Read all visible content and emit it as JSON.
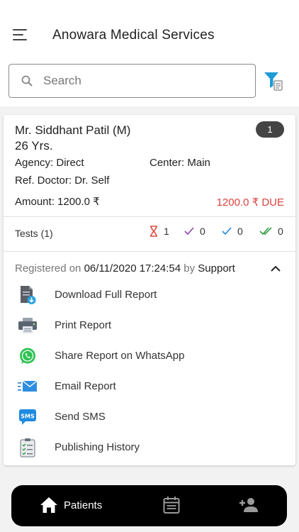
{
  "header": {
    "title": "Anowara Medical Services"
  },
  "search": {
    "placeholder": "Search",
    "value": ""
  },
  "patient": {
    "name": "Mr. Siddhant Patil (M)",
    "age": "26 Yrs.",
    "count": "1",
    "agency_label": "Agency:",
    "agency": "Direct",
    "center_label": "Center:",
    "center": "Main",
    "ref_label": "Ref. Doctor:",
    "ref_doctor": "Dr. Self",
    "amount_label": "Amount:",
    "amount": "1200.0 ₹",
    "due": "1200.0 ₹ DUE",
    "tests_label": "Tests (1)",
    "stats": {
      "pending": "1",
      "verified": "0",
      "approved": "0",
      "delivered": "0"
    },
    "registration": {
      "prefix": "Registered on",
      "datetime": "06/11/2020 17:24:54",
      "by": "by",
      "user": "Support"
    }
  },
  "actions": [
    {
      "label": "Download Full Report",
      "icon": "download-report-icon"
    },
    {
      "label": "Print Report",
      "icon": "printer-icon"
    },
    {
      "label": "Share Report on WhatsApp",
      "icon": "whatsapp-icon"
    },
    {
      "label": "Email Report",
      "icon": "email-icon"
    },
    {
      "label": "Send SMS",
      "icon": "sms-icon"
    },
    {
      "label": "Publishing History",
      "icon": "clipboard-checklist-icon"
    }
  ],
  "nav": {
    "home_label": "Patients"
  },
  "colors": {
    "due": "#d9433f",
    "pending": "#e04a3c",
    "verified": "#8e44ad",
    "approved": "#1e88e5",
    "delivered": "#2e9e44",
    "filter": "#1e9bd7"
  }
}
